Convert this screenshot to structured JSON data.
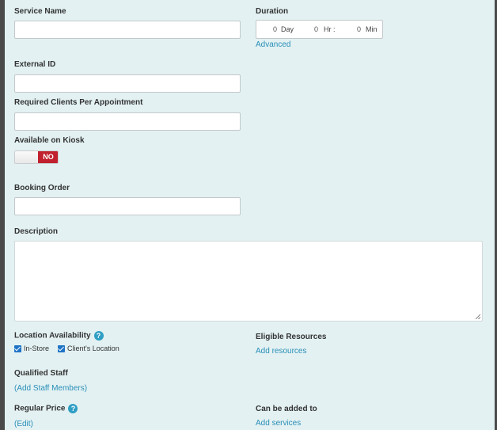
{
  "form": {
    "service_name": {
      "label": "Service Name",
      "value": ""
    },
    "duration": {
      "label": "Duration",
      "day_value": "0",
      "day_unit": "Day",
      "hr_value": "0",
      "hr_unit": "Hr :",
      "min_value": "0",
      "min_unit": "Min",
      "advanced_link": "Advanced"
    },
    "external_id": {
      "label": "External ID",
      "value": ""
    },
    "required_clients": {
      "label": "Required Clients Per Appointment",
      "value": ""
    },
    "kiosk": {
      "label": "Available on Kiosk",
      "toggle_text": "NO"
    },
    "booking_order": {
      "label": "Booking Order",
      "value": ""
    },
    "description": {
      "label": "Description",
      "value": ""
    },
    "location": {
      "label": "Location Availability",
      "help": "?",
      "options": [
        {
          "label": "In-Store",
          "checked": true
        },
        {
          "label": "Client's Location",
          "checked": true
        }
      ]
    },
    "eligible_resources": {
      "label": "Eligible Resources",
      "link": "Add resources"
    },
    "qualified_staff": {
      "label": "Qualified Staff",
      "link": "(Add Staff Members)"
    },
    "regular_price": {
      "label": "Regular Price",
      "help": "?",
      "link": "(Edit)"
    },
    "can_be_added": {
      "label": "Can be added to",
      "link": "Add services"
    }
  },
  "colors": {
    "background": "#e3f1f2",
    "link": "#2a8fb8",
    "toggle_off": "#c1202f",
    "help_icon": "#2f9ec4"
  }
}
